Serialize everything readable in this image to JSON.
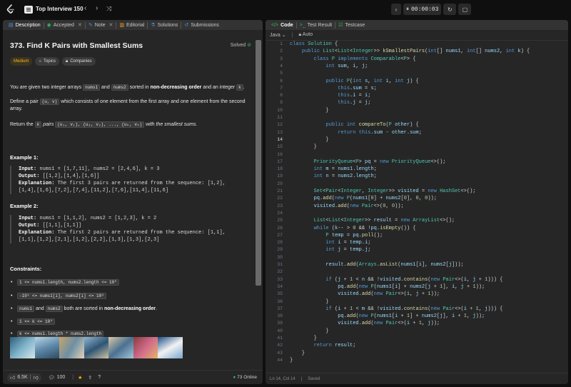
{
  "topbar": {
    "study_plan": "Top Interview 150",
    "timer": "00:00:03"
  },
  "left_tabs": [
    {
      "label": "Description"
    },
    {
      "label": "Accepted"
    },
    {
      "label": "Note"
    },
    {
      "label": "Editorial"
    },
    {
      "label": "Solutions"
    },
    {
      "label": "Submissions"
    }
  ],
  "problem": {
    "title": "373. Find K Pairs with Smallest Sums",
    "status": "Solved",
    "difficulty": "Medium",
    "tags": [
      "Topics",
      "Companies"
    ],
    "p1_a": "You are given two integer arrays ",
    "p1_c1": "nums1",
    "p1_b": " and ",
    "p1_c2": "nums2",
    "p1_d": " sorted in ",
    "p1_bold": "non-decreasing order",
    "p1_e": " and an integer ",
    "p1_c3": "k",
    "p1_f": ".",
    "p2_a": "Define a pair ",
    "p2_c1": "(u, v)",
    "p2_b": " which consists of one element from the first array and one element from the second array.",
    "p3_a": "Return the ",
    "p3_c1": "k",
    "p3_b": " pairs ",
    "p3_c2": "(u₁, v₁), (u₂, v₂), ..., (uₖ, vₖ)",
    "p3_c": " with the smallest sums."
  },
  "examples": [
    {
      "heading": "Example 1:",
      "input_label": "Input:",
      "input": " nums1 = [1,7,11], nums2 = [2,4,6], k = 3",
      "output_label": "Output:",
      "output": " [[1,2],[1,4],[1,6]]",
      "expl_label": "Explanation:",
      "expl1": " The first 3 pairs are returned from the sequence: [1,2],",
      "expl2": "[1,4],[1,6],[7,2],[7,4],[11,2],[7,6],[11,4],[11,6]"
    },
    {
      "heading": "Example 2:",
      "input_label": "Input:",
      "input": " nums1 = [1,1,2], nums2 = [1,2,3], k = 2",
      "output_label": "Output:",
      "output": " [[1,1],[1,1]]",
      "expl_label": "Explanation:",
      "expl1": " The first 2 pairs are returned from the sequence: [1,1],",
      "expl2": "[1,1],[1,2],[2,1],[1,2],[2,2],[1,3],[1,3],[2,3]"
    }
  ],
  "constraints": {
    "heading": "Constraints:",
    "c1": "1 <= nums1.length, nums2.length <= 10⁵",
    "c2": "-10⁹ <= nums1[i], nums2[i] <= 10⁹",
    "c3_a": "nums1",
    "c3_b": " and ",
    "c3_c": "nums2",
    "c3_d": " both are sorted in ",
    "c3_e": "non-decreasing order",
    "c3_f": ".",
    "c4": "1 <= k <= 10⁴",
    "c5": "k <= nums1.length * nums2.length"
  },
  "left_footer": {
    "likes": "6.5K",
    "comments": "100",
    "online": "73 Online"
  },
  "right_tabs": [
    {
      "label": "Code"
    },
    {
      "label": "Test Result"
    },
    {
      "label": "Testcase"
    }
  ],
  "editor": {
    "language": "Java",
    "mode": "Auto",
    "cursor": "Ln 14, Col 14",
    "saved": "Saved",
    "lines": [
      "class Solution {",
      "    public List<List<Integer>> kSmallestPairs(int[] nums1, int[] nums2, int k) {",
      "        class P implements Comparable<P> {",
      "            int sum, i, j;",
      "",
      "            public P(int s, int i, int j) {",
      "                this.sum = s;",
      "                this.i = i;",
      "                this.j = j;",
      "            }",
      "",
      "            public int compareTo(P other) {",
      "                return this.sum - other.sum;",
      "            }",
      "        }",
      "",
      "        PriorityQueue<P> pq = new PriorityQueue<>();",
      "        int m = nums1.length;",
      "        int n = nums2.length;",
      "",
      "        Set<Pair<Integer, Integer>> visited = new HashSet<>();",
      "        pq.add(new P(nums1[0] + nums2[0], 0, 0));",
      "        visited.add(new Pair<>(0, 0));",
      "",
      "        List<List<Integer>> result = new ArrayList<>();",
      "        while (k-- > 0 && !pq.isEmpty()) {",
      "            P temp = pq.poll();",
      "            int i = temp.i;",
      "            int j = temp.j;",
      "",
      "            result.add(Arrays.asList(nums1[i], nums2[j]));",
      "",
      "            if (j + 1 < n && !visited.contains(new Pair<>(i, j + 1))) {",
      "                pq.add(new P(nums1[i] + nums2[j + 1], i, j + 1));",
      "                visited.add(new Pair<>(i, j + 1));",
      "            }",
      "            if (i + 1 < m && !visited.contains(new Pair<>(i + 1, j))) {",
      "                pq.add(new P(nums1[i + 1] + nums2[j], i + 1, j));",
      "                visited.add(new Pair<>(i + 1, j));",
      "            }",
      "        }",
      "        return result;",
      "    }",
      "}"
    ]
  },
  "colors": {
    "accent_green": "#2cbb5d",
    "difficulty_medium": "#ffb700",
    "code_tab_icon": "#2cbb5d"
  }
}
